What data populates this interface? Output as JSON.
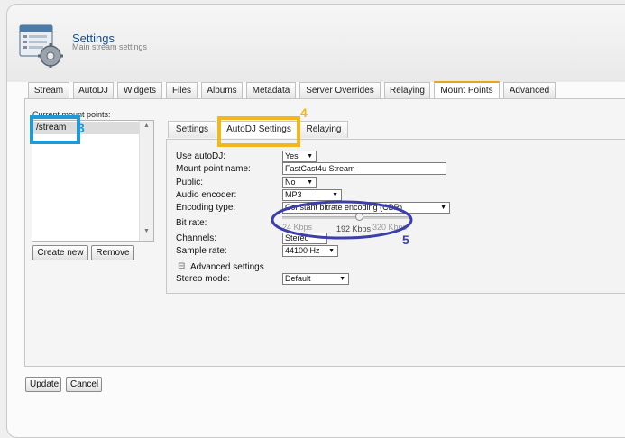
{
  "header": {
    "title": "Settings",
    "subtitle": "Main stream settings"
  },
  "tabs": [
    {
      "label": "Stream",
      "active": false
    },
    {
      "label": "AutoDJ",
      "active": false
    },
    {
      "label": "Widgets",
      "active": false
    },
    {
      "label": "Files",
      "active": false
    },
    {
      "label": "Albums",
      "active": false
    },
    {
      "label": "Metadata",
      "active": false
    },
    {
      "label": "Server Overrides",
      "active": false
    },
    {
      "label": "Relaying",
      "active": false
    },
    {
      "label": "Mount Points",
      "active": true
    },
    {
      "label": "Advanced",
      "active": false
    }
  ],
  "mount_points": {
    "label": "Current mount points:",
    "items": [
      "/stream"
    ],
    "create_label": "Create new",
    "remove_label": "Remove"
  },
  "subtabs": [
    {
      "label": "Settings",
      "active": false
    },
    {
      "label": "AutoDJ Settings",
      "active": true
    },
    {
      "label": "Relaying",
      "active": false
    }
  ],
  "form": {
    "use_autodj": {
      "label": "Use autoDJ:",
      "value": "Yes"
    },
    "mount_name": {
      "label": "Mount point name:",
      "value": "FastCast4u Stream"
    },
    "public": {
      "label": "Public:",
      "value": "No"
    },
    "audio_encoder": {
      "label": "Audio encoder:",
      "value": "MP3"
    },
    "encoding_type": {
      "label": "Encoding type:",
      "value": "Constant bitrate encoding (CBR)"
    },
    "bit_rate": {
      "label": "Bit rate:",
      "min": "24 Kbps",
      "current": "192 Kbps",
      "max": "320 Kbps",
      "level_fraction": 0.6
    },
    "channels": {
      "label": "Channels:",
      "value": "Stereo"
    },
    "sample_rate": {
      "label": "Sample rate:",
      "value": "44100 Hz"
    },
    "advanced": {
      "label": "Advanced settings",
      "toggle": "⊟"
    },
    "stereo_mode": {
      "label": "Stereo mode:",
      "value": "Default"
    }
  },
  "actions": {
    "update_label": "Update",
    "cancel_label": "Cancel"
  },
  "annotations": [
    {
      "number": "3",
      "color": "#1f9ad6"
    },
    {
      "number": "4",
      "color": "#f2b71b"
    },
    {
      "number": "5",
      "color": "#3d3fa8"
    }
  ],
  "colors": {
    "title": "#1b4f7f",
    "active_tab_accent": "#e7a51f"
  }
}
